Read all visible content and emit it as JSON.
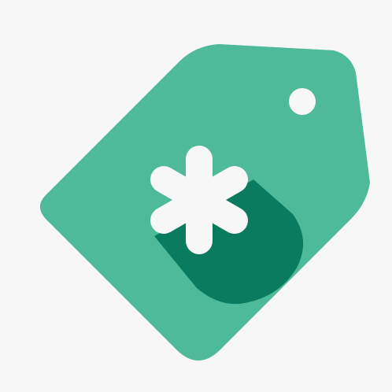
{
  "app": {
    "title": "",
    "icon": "asterisk-price-tag-icon"
  },
  "colors": {
    "background": "#f7f7f7",
    "tag": "#4fba9a",
    "shadow": "#0b7b60",
    "asterisk": "#f7f7f7",
    "hole": "#f7f7f7"
  }
}
